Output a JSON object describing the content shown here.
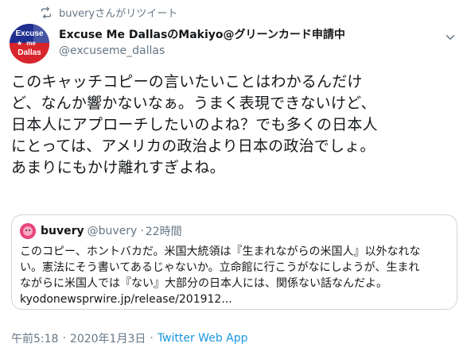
{
  "retweet": {
    "label": "buveryさんがリツイート",
    "icon": "retweet-icon"
  },
  "author": {
    "avatar_text_1": "Excuse",
    "avatar_text_2": "me",
    "avatar_text_3": "Dallas",
    "name": "Excuse Me DallasのMakiyo@グリーンカード申請中",
    "handle": "@excuseme_dallas"
  },
  "tweet": {
    "lines": [
      "このキャッチコピーの言いたいことはわかるんだけ",
      "ど、なんか響かないなぁ。うまく表現できないけど、",
      "日本人にアプローチしたいのよね？でも多くの日本人",
      "にとっては、アメリカの政治より日本の政治でしょ。",
      "あまりにもかけ離れすぎよね。"
    ]
  },
  "quote": {
    "name": "buvery",
    "handle": "@buvery",
    "separator": "·",
    "time": "22時間",
    "lines": [
      "このコピー、ホントバカだ。米国大統領は『生まれながらの米国人』以外なれな",
      "い。憲法にそう書いてあるじゃないか。立命館に行こうがなにしようが、生まれ",
      "ながらに米国人では『ない』大部分の日本人には、関係ない話なんだよ。",
      "kyodonewsprwire.jp/release/201912..."
    ]
  },
  "meta": {
    "time": "午前5:18",
    "separator": "·",
    "date": "2020年1月3日",
    "separator2": "·",
    "app": "Twitter Web App"
  },
  "colors": {
    "text": "#14171a",
    "secondary": "#657786",
    "link": "#1b95e0",
    "border": "#ccd6dd"
  }
}
